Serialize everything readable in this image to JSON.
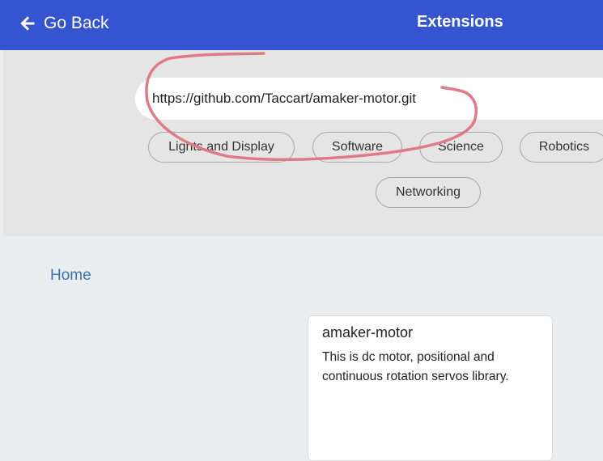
{
  "colors": {
    "header_bg": "#3454d1",
    "annotation_stroke": "#e07a86",
    "link": "#3b73b9"
  },
  "header": {
    "back_label": "Go Back",
    "back_icon": "arrow-left-icon",
    "title": "Extensions"
  },
  "search": {
    "value": "https://github.com/Taccart/amaker-motor.git"
  },
  "categories": [
    "Lights and Display",
    "Software",
    "Science",
    "Robotics",
    "Networking"
  ],
  "breadcrumb": {
    "home": "Home"
  },
  "results": [
    {
      "title": "amaker-motor",
      "description": "This is dc motor, positional and continuous rotation servos library."
    }
  ]
}
